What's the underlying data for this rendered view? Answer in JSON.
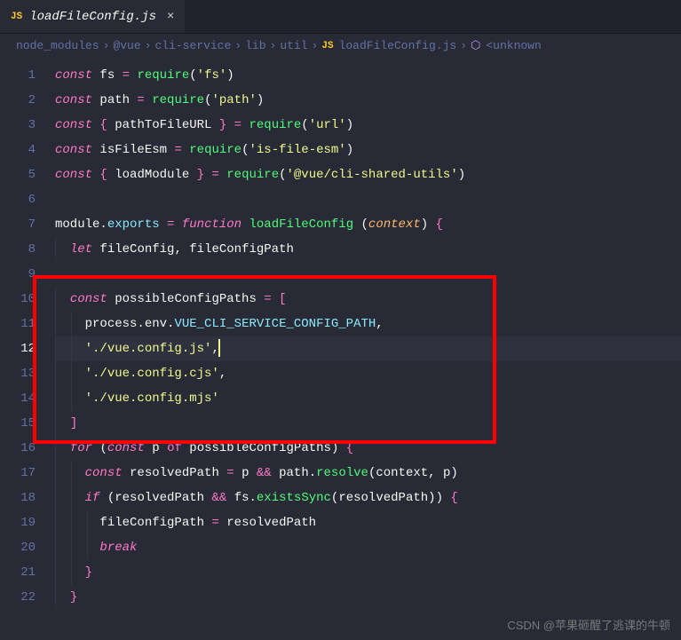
{
  "tab": {
    "icon_label": "JS",
    "filename": "loadFileConfig.js",
    "close": "×"
  },
  "breadcrumbs": {
    "items": [
      "node_modules",
      "@vue",
      "cli-service",
      "lib",
      "util"
    ],
    "file_icon": "JS",
    "file": "loadFileConfig.js",
    "symbol_icon": "⬡",
    "symbol": "<unknown"
  },
  "lines": {
    "l1": {
      "gutter": "1"
    },
    "l2": {
      "gutter": "2"
    },
    "l3": {
      "gutter": "3"
    },
    "l4": {
      "gutter": "4"
    },
    "l5": {
      "gutter": "5"
    },
    "l6": {
      "gutter": "6"
    },
    "l7": {
      "gutter": "7"
    },
    "l8": {
      "gutter": "8"
    },
    "l9": {
      "gutter": "9"
    },
    "l10": {
      "gutter": "10"
    },
    "l11": {
      "gutter": "11"
    },
    "l12": {
      "gutter": "12"
    },
    "l13": {
      "gutter": "13"
    },
    "l14": {
      "gutter": "14"
    },
    "l15": {
      "gutter": "15"
    },
    "l16": {
      "gutter": "16"
    },
    "l17": {
      "gutter": "17"
    },
    "l18": {
      "gutter": "18"
    },
    "l19": {
      "gutter": "19"
    },
    "l20": {
      "gutter": "20"
    },
    "l21": {
      "gutter": "21"
    },
    "l22": {
      "gutter": "22"
    }
  },
  "tokens": {
    "const": "const",
    "let": "let",
    "for": "for",
    "if": "if",
    "of": "of",
    "break": "break",
    "function": "function",
    "require": "require",
    "fs": "fs",
    "path": "path",
    "pathToFileURL": "pathToFileURL",
    "isFileEsm": "isFileEsm",
    "loadModule": "loadModule",
    "module": "module",
    "exports": "exports",
    "loadFileConfig": "loadFileConfig",
    "context": "context",
    "fileConfig": "fileConfig",
    "fileConfigPath": "fileConfigPath",
    "possibleConfigPaths": "possibleConfigPaths",
    "process": "process",
    "env": "env",
    "VUE_CLI_SERVICE_CONFIG_PATH": "VUE_CLI_SERVICE_CONFIG_PATH",
    "p": "p",
    "resolvedPath": "resolvedPath",
    "resolve": "resolve",
    "existsSync": "existsSync",
    "eq": " = ",
    "and": "&&",
    "lparen": "(",
    "rparen": ")",
    "lbrace": "{",
    "rbrace": "}",
    "lbracket": "[",
    "rbracket": "]",
    "comma": ",",
    "dot": ".",
    "s_fs": "'fs'",
    "s_path": "'path'",
    "s_url": "'url'",
    "s_isfileesm": "'is-file-esm'",
    "s_cli": "'@vue/cli-shared-utils'",
    "s_cfg_js": "'./vue.config.js'",
    "s_cfg_cjs": "'./vue.config.cjs'",
    "s_cfg_mjs": "'./vue.config.mjs'"
  },
  "watermark": "CSDN @苹果砸醒了逃课的牛顿"
}
